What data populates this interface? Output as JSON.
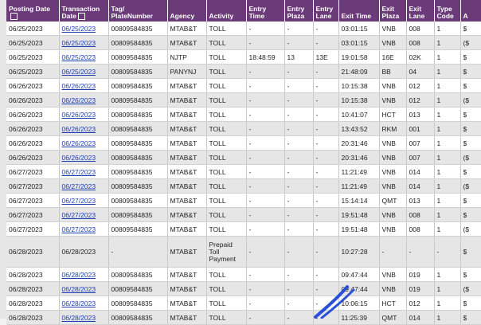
{
  "headers": [
    "Posting Date",
    "Transaction Date",
    "Tag/ PlateNumber",
    "Agency",
    "Activity",
    "Entry Time",
    "Entry Plaza",
    "Entry Lane",
    "Exit Time",
    "Exit Plaza",
    "Exit Lane",
    "Type Code",
    "A"
  ],
  "rows": [
    [
      "06/25/2023",
      "06/25/2023",
      "00809584835",
      "MTAB&T",
      "TOLL",
      "-",
      "-",
      "-",
      "03:01:15",
      "VNB",
      "008",
      "1",
      "$"
    ],
    [
      "06/25/2023",
      "06/25/2023",
      "00809584835",
      "MTAB&T",
      "TOLL",
      "-",
      "-",
      "-",
      "03:01:15",
      "VNB",
      "008",
      "1",
      "($"
    ],
    [
      "06/25/2023",
      "06/25/2023",
      "00809584835",
      "NJTP",
      "TOLL",
      "18:48:59",
      "13",
      "13E",
      "19:01:58",
      "16E",
      "02K",
      "1",
      "$"
    ],
    [
      "06/25/2023",
      "06/25/2023",
      "00809584835",
      "PANYNJ",
      "TOLL",
      "-",
      "-",
      "-",
      "21:48:09",
      "BB",
      "04",
      "1",
      "$"
    ],
    [
      "06/26/2023",
      "06/26/2023",
      "00809584835",
      "MTAB&T",
      "TOLL",
      "-",
      "-",
      "-",
      "10:15:38",
      "VNB",
      "012",
      "1",
      "$"
    ],
    [
      "06/26/2023",
      "06/26/2023",
      "00809584835",
      "MTAB&T",
      "TOLL",
      "-",
      "-",
      "-",
      "10:15:38",
      "VNB",
      "012",
      "1",
      "($"
    ],
    [
      "06/26/2023",
      "06/26/2023",
      "00809584835",
      "MTAB&T",
      "TOLL",
      "-",
      "-",
      "-",
      "10:41:07",
      "HCT",
      "013",
      "1",
      "$"
    ],
    [
      "06/26/2023",
      "06/26/2023",
      "00809584835",
      "MTAB&T",
      "TOLL",
      "-",
      "-",
      "-",
      "13:43:52",
      "RKM",
      "001",
      "1",
      "$"
    ],
    [
      "06/26/2023",
      "06/26/2023",
      "00809584835",
      "MTAB&T",
      "TOLL",
      "-",
      "-",
      "-",
      "20:31:46",
      "VNB",
      "007",
      "1",
      "$"
    ],
    [
      "06/26/2023",
      "06/26/2023",
      "00809584835",
      "MTAB&T",
      "TOLL",
      "-",
      "-",
      "-",
      "20:31:46",
      "VNB",
      "007",
      "1",
      "($"
    ],
    [
      "06/27/2023",
      "06/27/2023",
      "00809584835",
      "MTAB&T",
      "TOLL",
      "-",
      "-",
      "-",
      "11:21:49",
      "VNB",
      "014",
      "1",
      "$"
    ],
    [
      "06/27/2023",
      "06/27/2023",
      "00809584835",
      "MTAB&T",
      "TOLL",
      "-",
      "-",
      "-",
      "11:21:49",
      "VNB",
      "014",
      "1",
      "($"
    ],
    [
      "06/27/2023",
      "06/27/2023",
      "00809584835",
      "MTAB&T",
      "TOLL",
      "-",
      "-",
      "-",
      "15:14:14",
      "QMT",
      "013",
      "1",
      "$"
    ],
    [
      "06/27/2023",
      "06/27/2023",
      "00809584835",
      "MTAB&T",
      "TOLL",
      "-",
      "-",
      "-",
      "19:51:48",
      "VNB",
      "008",
      "1",
      "$"
    ],
    [
      "06/27/2023",
      "06/27/2023",
      "00809584835",
      "MTAB&T",
      "TOLL",
      "-",
      "-",
      "-",
      "19:51:48",
      "VNB",
      "008",
      "1",
      "($"
    ],
    [
      "06/28/2023",
      "06/28/2023",
      "-",
      "MTAB&T",
      "Prepaid Toll Payment",
      "-",
      "-",
      "-",
      "10:27:28",
      "-",
      "-",
      "-",
      "$"
    ],
    [
      "06/28/2023",
      "06/28/2023",
      "00809584835",
      "MTAB&T",
      "TOLL",
      "-",
      "-",
      "-",
      "09:47:44",
      "VNB",
      "019",
      "1",
      "$"
    ],
    [
      "06/28/2023",
      "06/28/2023",
      "00809584835",
      "MTAB&T",
      "TOLL",
      "-",
      "-",
      "-",
      "09:47:44",
      "VNB",
      "019",
      "1",
      "($"
    ],
    [
      "06/28/2023",
      "06/28/2023",
      "00809584835",
      "MTAB&T",
      "TOLL",
      "-",
      "-",
      "-",
      "10:06:15",
      "HCT",
      "012",
      "1",
      "$"
    ],
    [
      "06/28/2023",
      "06/28/2023",
      "00809584835",
      "MTAB&T",
      "TOLL",
      "-",
      "-",
      "-",
      "11:25:39",
      "QMT",
      "014",
      "1",
      "$"
    ]
  ],
  "linked_rows": [
    0,
    1,
    2,
    3,
    4,
    5,
    6,
    7,
    8,
    9,
    10,
    11,
    12,
    13,
    14,
    16,
    17,
    18,
    19
  ],
  "tall_rows": [
    15
  ],
  "colors": {
    "header_bg": "#6b3a78",
    "link": "#1a3fb0",
    "row_alt": "#e6e6e6",
    "stroke": "#2a4fd8"
  }
}
